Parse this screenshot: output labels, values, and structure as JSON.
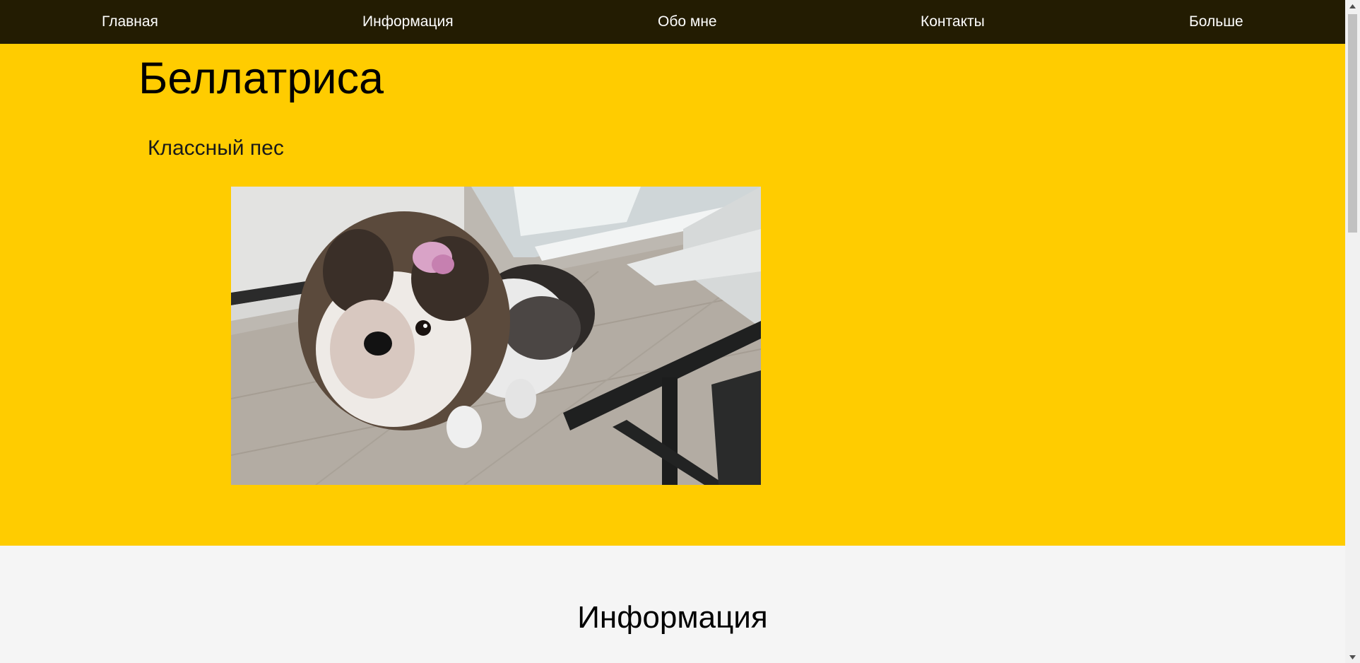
{
  "nav": {
    "items": [
      {
        "label": "Главная"
      },
      {
        "label": "Информация"
      },
      {
        "label": "Обо мне"
      },
      {
        "label": "Контакты"
      },
      {
        "label": "Больше"
      }
    ]
  },
  "hero": {
    "title": "Беллатриса",
    "subtitle": "Классный пес"
  },
  "info": {
    "title": "Информация"
  },
  "colors": {
    "navbar_bg": "#231c02",
    "hero_bg": "#ffcc00",
    "page_bg": "#f5f5f5"
  },
  "icons": {
    "scroll_up": "triangle-up-icon",
    "scroll_down": "triangle-down-icon"
  }
}
